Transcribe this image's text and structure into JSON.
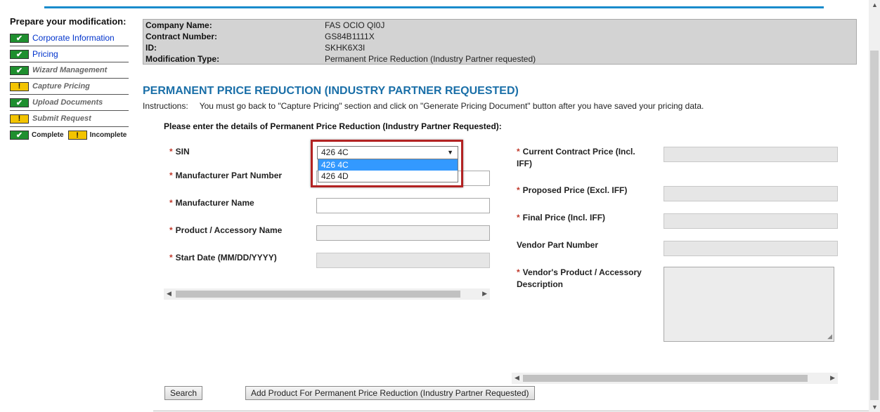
{
  "sidebar": {
    "title": "Prepare your modification:",
    "items": [
      {
        "label": "Corporate Information",
        "status": "complete",
        "style": "link"
      },
      {
        "label": "Pricing",
        "status": "complete",
        "style": "link"
      },
      {
        "label": "Wizard Management",
        "status": "complete",
        "style": "italic"
      },
      {
        "label": "Capture Pricing",
        "status": "incomplete",
        "style": "italic"
      },
      {
        "label": "Upload Documents",
        "status": "complete",
        "style": "italic"
      },
      {
        "label": "Submit Request",
        "status": "incomplete",
        "style": "italic"
      }
    ],
    "legend": {
      "complete": "Complete",
      "incomplete": "Incomplete",
      "complete_icon": "✔",
      "incomplete_icon": "!"
    }
  },
  "info": {
    "company_label": "Company Name:",
    "company_value": "FAS OCIO QI0J",
    "contract_label": "Contract Number:",
    "contract_value": "GS84B1111X",
    "id_label": "ID:",
    "id_value": "SKHK6X3I",
    "modtype_label": "Modification Type:",
    "modtype_value": "Permanent Price Reduction (Industry Partner requested)"
  },
  "heading": "PERMANENT PRICE REDUCTION (INDUSTRY PARTNER REQUESTED)",
  "instructions": {
    "label": "Instructions:",
    "text": "You must go back to \"Capture Pricing\" section and click on \"Generate Pricing Document\" button after you have saved your pricing data."
  },
  "form": {
    "subheading": "Please enter the details of Permanent Price Reduction (Industry Partner Requested):",
    "required_marker": "*",
    "sin_label": "SIN",
    "sin_selected": "426 4C",
    "sin_options": [
      "426 4C",
      "426 4D"
    ],
    "mpn_label": "Manufacturer Part Number",
    "mfr_name_label": "Manufacturer Name",
    "product_name_label": "Product / Accessory Name",
    "start_date_label": "Start Date (MM/DD/YYYY)",
    "current_price_label": "Current Contract Price (Incl. IFF)",
    "proposed_price_label": "Proposed Price (Excl. IFF)",
    "final_price_label": "Final Price (Incl. IFF)",
    "vendor_pn_label": "Vendor Part Number",
    "vendor_desc_label": "Vendor's Product / Accessory Description"
  },
  "buttons": {
    "search": "Search",
    "add_product": "Add Product For Permanent Price Reduction (Industry Partner Requested)"
  },
  "colors": {
    "accent": "#1a8ccc",
    "heading": "#1a6fa8",
    "complete": "#1f8f2f",
    "incomplete": "#f3c400",
    "highlight": "#b22222"
  }
}
